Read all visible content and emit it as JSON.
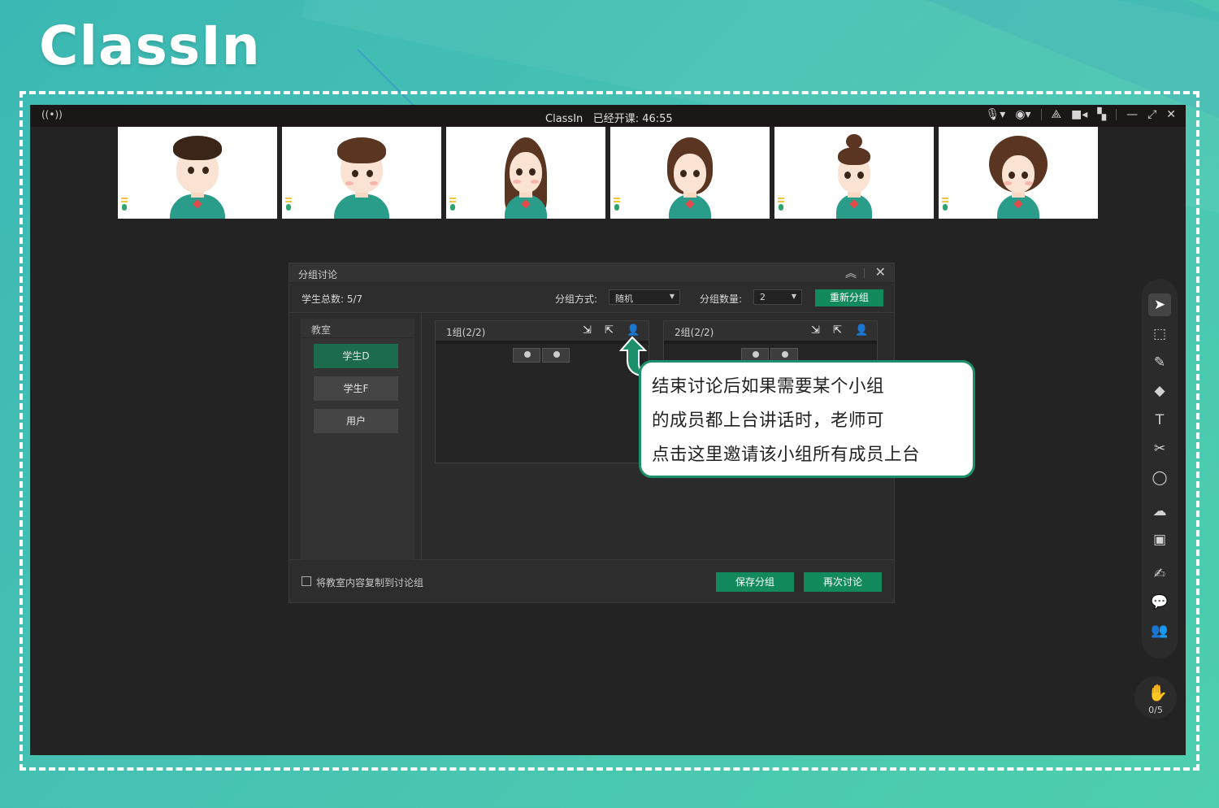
{
  "brand": {
    "logo": "ClassIn"
  },
  "titlebar": {
    "title": "ClassIn",
    "status": "已经开课: 46:55",
    "icons": [
      "broadcast-icon",
      "mic-icon",
      "camera-icon",
      "share-icon",
      "video-icon",
      "grid-icon",
      "minimize-icon",
      "maximize-icon",
      "close-icon"
    ]
  },
  "video_tiles": [
    {
      "name": "student-1"
    },
    {
      "name": "student-2"
    },
    {
      "name": "student-3"
    },
    {
      "name": "student-4"
    },
    {
      "name": "student-5"
    },
    {
      "name": "student-6"
    }
  ],
  "dialog": {
    "title": "分组讨论",
    "total_label": "学生总数: 5/7",
    "mode_label": "分组方式:",
    "mode_value": "随机",
    "count_label": "分组数量:",
    "count_value": "2",
    "regroup_button": "重新分组",
    "classroom": {
      "title": "教室",
      "students": [
        "学生D",
        "学生F",
        "用户"
      ]
    },
    "groups": [
      {
        "title": "1组(2/2)"
      },
      {
        "title": "2组(2/2)"
      }
    ],
    "copy_checkbox_label": "将教室内容复制到讨论组",
    "save_button": "保存分组",
    "again_button": "再次讨论"
  },
  "toolbar": {
    "tools": [
      "cursor-icon",
      "select-area-icon",
      "pen-icon",
      "eraser-icon",
      "text-icon",
      "scissors-icon",
      "shape-icon",
      "cloud-icon",
      "toolbox-icon",
      "edit-icon",
      "chat-icon",
      "users-icon"
    ]
  },
  "hand_raise": {
    "count": "0/5"
  },
  "callout": {
    "lines": [
      "结束讨论后如果需要某个小组",
      "的成员都上台讲话时，老师可",
      "点击这里邀请该小组所有成员上台"
    ]
  }
}
